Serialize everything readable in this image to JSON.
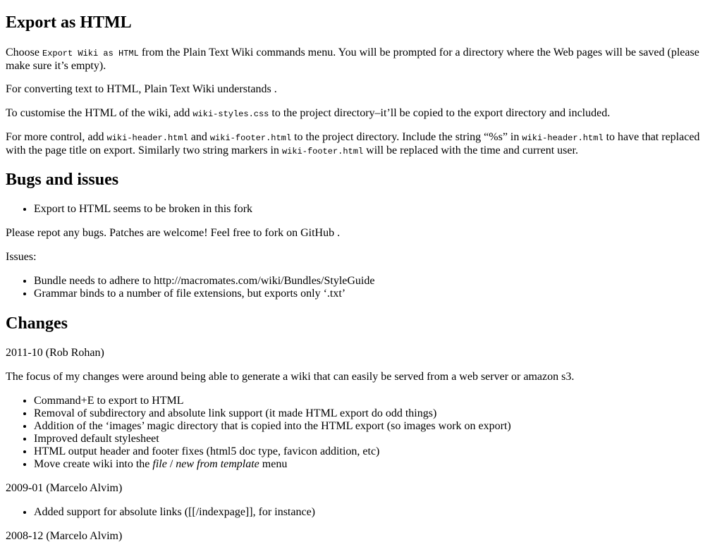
{
  "export_section": {
    "heading": "Export as HTML",
    "p1": {
      "t1": "Choose ",
      "code1": "Export Wiki as HTML",
      "t2": " from the Plain Text Wiki commands menu. You will be prompted for a directory where the Web pages will be saved (please make sure it’s empty)."
    },
    "p2": "For converting text to HTML, Plain Text Wiki understands .",
    "p3": {
      "t1": "To customise the HTML of the wiki, add ",
      "code1": "wiki-styles.css",
      "t2": " to the project directory–it’ll be copied to the export directory and included."
    },
    "p4": {
      "t1": "For more control, add ",
      "code1": "wiki-header.html",
      "t2": " and ",
      "code2": "wiki-footer.html",
      "t3": " to the project directory. Include the string “%s” in ",
      "code3": "wiki-header.html",
      "t4": " to have that replaced with the page title on export. Similarly two string markers in ",
      "code4": "wiki-footer.html",
      "t5": " will be replaced with the time and current user."
    }
  },
  "bugs_section": {
    "heading": "Bugs and issues",
    "list1": [
      "Export to HTML seems to be broken in this fork"
    ],
    "p1": "Please repot any bugs. Patches are welcome! Feel free to fork on GitHub .",
    "p2": "Issues:",
    "list2": [
      "Bundle needs to adhere to http://macromates.com/wiki/Bundles/StyleGuide",
      "Grammar binds to a number of file extensions, but exports only ‘.txt’"
    ]
  },
  "changes_section": {
    "heading": "Changes",
    "entry1_date": "2011-10 (Rob Rohan)",
    "entry1_desc": "The focus of my changes were around being able to generate a wiki that can easily be served from a web server or amazon s3.",
    "entry1_items": [
      "Command+E to export to HTML",
      "Removal of subdirectory and absolute link support (it made HTML export do odd things)",
      "Addition of the ‘images’ magic directory that is copied into the HTML export (so images work on export)",
      "Improved default stylesheet",
      "HTML output header and footer fixes (html5 doc type, favicon addition, etc)"
    ],
    "entry1_last": {
      "t1": "Move create wiki into the ",
      "em1": "file",
      "t2": " / ",
      "em2": "new from template",
      "t3": " menu"
    },
    "entry2_date": "2009-01 (Marcelo Alvim)",
    "entry2_items": [
      "Added support for absolute links ([[/indexpage]], for instance)"
    ],
    "entry3_date": "2008-12 (Marcelo Alvim)"
  }
}
